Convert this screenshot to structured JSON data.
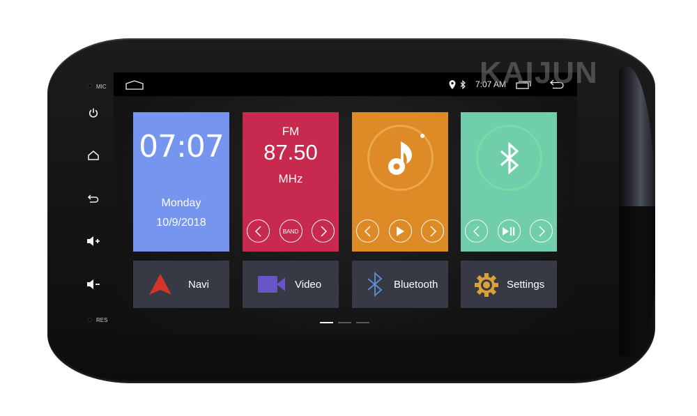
{
  "device": {
    "brand": "KAIJUN",
    "side_labels": {
      "mic": "MIC",
      "reset": "RES"
    },
    "side_buttons": [
      {
        "name": "power",
        "icon": "power-icon"
      },
      {
        "name": "home",
        "icon": "home-icon"
      },
      {
        "name": "back",
        "icon": "back-icon"
      },
      {
        "name": "volume-up",
        "icon": "volume-up-icon"
      },
      {
        "name": "volume-down",
        "icon": "volume-down-icon"
      }
    ]
  },
  "statusbar": {
    "home_icon": "home-outline-icon",
    "location_icon": "location-pin-icon",
    "bluetooth_icon": "bluetooth-icon",
    "time": "7:07 AM",
    "recents_icon": "recent-apps-icon",
    "back_icon": "back-arrow-icon"
  },
  "widgets": {
    "clock": {
      "time": "07:07",
      "day": "Monday",
      "date": "10/9/2018",
      "color": "#7595ef"
    },
    "radio": {
      "band": "FM",
      "frequency": "87.50",
      "unit": "MHz",
      "color": "#c8294f",
      "controls": {
        "prev": "prev-icon",
        "band_label": "BAND",
        "next": "next-icon"
      }
    },
    "music": {
      "icon": "music-note-icon",
      "color": "#de8a27",
      "controls": {
        "prev": "prev-icon",
        "play": "play-icon",
        "next": "next-icon"
      }
    },
    "bluetooth_audio": {
      "icon": "bluetooth-icon",
      "color": "#70ceab",
      "controls": {
        "prev": "prev-icon",
        "play_pause": "play-pause-icon",
        "next": "next-icon"
      }
    }
  },
  "apps": [
    {
      "label": "Navi",
      "icon": "navigation-arrow-icon",
      "icon_color": "#d4342b"
    },
    {
      "label": "Video",
      "icon": "video-camera-icon",
      "icon_color": "#6a55c6"
    },
    {
      "label": "Bluetooth",
      "icon": "bluetooth-icon",
      "icon_color": "#5d8fdc"
    },
    {
      "label": "Settings",
      "icon": "gear-icon",
      "icon_color": "#d8a13a"
    }
  ],
  "pager": {
    "pages": 3,
    "current": 1
  }
}
